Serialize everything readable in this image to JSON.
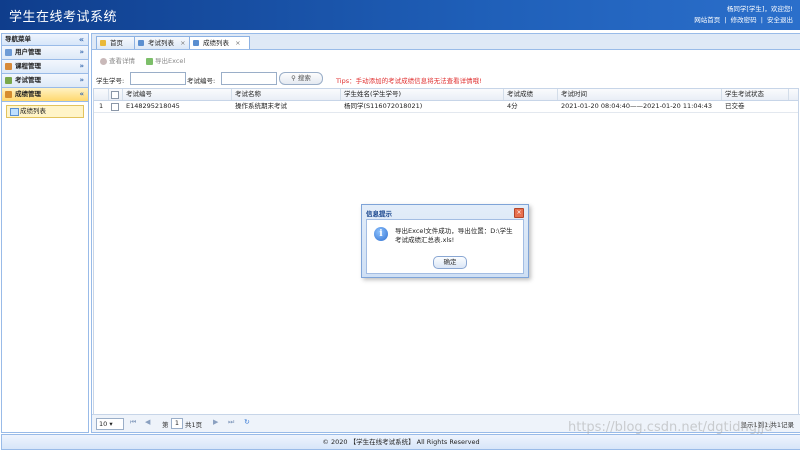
{
  "header": {
    "title": "学生在线考试系统",
    "greeting": "杨同学[学生]，欢迎您!",
    "links": [
      "网站首页",
      "修改密码",
      "安全退出"
    ],
    "separator": "|"
  },
  "sidebar": {
    "title": "导航菜单",
    "collapse_icon": "«",
    "sections": [
      {
        "label": "用户管理",
        "chevron": "»",
        "icon_color": "#6d9bd6"
      },
      {
        "label": "课程管理",
        "chevron": "»",
        "icon_color": "#d78a3a"
      },
      {
        "label": "考试管理",
        "chevron": "»",
        "icon_color": "#7aa84a"
      },
      {
        "label": "成绩管理",
        "chevron": "«",
        "icon_color": "#d58c2e"
      }
    ],
    "active_item": "成绩列表"
  },
  "tabs": [
    {
      "label": "首页",
      "close": "",
      "icon_color": "#e9b93a"
    },
    {
      "label": "考试列表",
      "close": "×",
      "icon_color": "#5b8fd0"
    },
    {
      "label": "成绩列表",
      "close": "×",
      "icon_color": "#5b8fd0"
    }
  ],
  "toolbar": {
    "view_label": "查看详情",
    "export_label": "导出Excel"
  },
  "search": {
    "student_label": "学生学号:",
    "exam_label": "考试编号:",
    "button_label": "搜索",
    "button_icon": "magnifier-icon",
    "tips": "Tips：手动添加的考试成绩信息将无法查看详情哦!"
  },
  "table": {
    "columns": [
      "考试编号",
      "考试名称",
      "学生姓名(学生学号)",
      "考试成绩",
      "考试时间",
      "学生考试状态"
    ],
    "rows": [
      {
        "index": "1",
        "cells": [
          "E148295218045",
          "操作系统期末考试",
          "杨同学(S116072018021)",
          "4分",
          "2021-01-20 08:04:40——2021-01-20 11:04:43",
          "已交卷"
        ]
      }
    ]
  },
  "pager": {
    "page_size": "10",
    "page_prefix": "第",
    "page_value": "1",
    "page_suffix": "共1页",
    "summary": "显示1到1,共1记录"
  },
  "dialog": {
    "title": "信息提示",
    "message": "导出Excel文件成功，导出位置：D:\\学生考试成绩汇总表.xls!",
    "ok_label": "确定",
    "icon": "info-icon"
  },
  "footer": {
    "text": "© 2020 【学生在线考试系统】 All Rights Reserved"
  },
  "watermark": "https://blog.csdn.net/dgtidhgjjd",
  "colors": {
    "header": "#1f5fb8",
    "border": "#99bbe8",
    "tips": "#e03030",
    "active_section": "#ffd86e"
  }
}
